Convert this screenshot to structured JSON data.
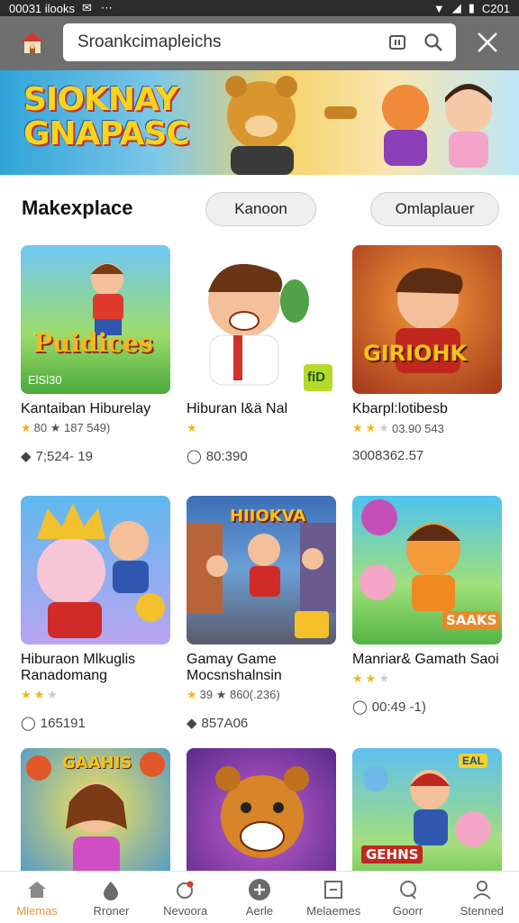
{
  "status_bar": {
    "left_text": "00031 ilooks",
    "time": "C201"
  },
  "search": {
    "value": "Sroankcimapleichs",
    "placeholder": ""
  },
  "banner": {
    "title_line1": "SIOKNAY",
    "title_line2": "GNAPASC"
  },
  "section": {
    "title": "Makexplace",
    "filters": [
      "Kanoon",
      "Omlaplauer"
    ]
  },
  "cards": [
    {
      "title": "Kantaiban Hiburelay",
      "meta": "80 ★ 187 549)",
      "rating": 1,
      "count": "7;524- 19",
      "thumb_label": "Puidices",
      "thumb_corner": "ElSl30"
    },
    {
      "title": "Hiburan l&ä Nal",
      "meta": "",
      "rating": 0,
      "count": "80:390",
      "thumb_label": "",
      "thumb_corner": "fiD"
    },
    {
      "title": "Kbarpl:lotibesb",
      "meta": "03.90 543",
      "rating": 2,
      "count": "3008362.57",
      "thumb_label": "GIRIOHK",
      "thumb_corner": ""
    },
    {
      "title": "Hiburaon Mlkuglis Ranadomang",
      "meta": "",
      "rating": 2,
      "count": "165191",
      "thumb_label": "",
      "thumb_corner": ""
    },
    {
      "title": "Gamay Game Mocsnshalnsin",
      "meta": "39 ★ 860(.236)",
      "rating": 1,
      "count": "857A06",
      "thumb_label": "HIIOKVA",
      "thumb_corner": ""
    },
    {
      "title": "Manriar& Gamath Saoi",
      "meta": "",
      "rating": 2,
      "count": "00:49 -1)",
      "thumb_label": "SAAKS",
      "thumb_corner": ""
    },
    {
      "title": "",
      "meta": "",
      "rating": 0,
      "count": "",
      "thumb_label": "GAAHIS",
      "thumb_corner": ""
    },
    {
      "title": "",
      "meta": "",
      "rating": 0,
      "count": "",
      "thumb_label": "",
      "thumb_corner": ""
    },
    {
      "title": "",
      "meta": "",
      "rating": 0,
      "count": "",
      "thumb_label": "GEHNS",
      "thumb_corner": "EAL"
    }
  ],
  "bottom_nav": [
    {
      "label": "Mlemas",
      "icon": "home-icon",
      "active": true
    },
    {
      "label": "Rroner",
      "icon": "drop-icon",
      "active": false
    },
    {
      "label": "Nevoora",
      "icon": "notification-icon",
      "active": false
    },
    {
      "label": "Aerle",
      "icon": "plus-circle-icon",
      "active": false
    },
    {
      "label": "Melaemes",
      "icon": "square-icon",
      "active": false
    },
    {
      "label": "Goorr",
      "icon": "search-icon",
      "active": false
    },
    {
      "label": "Stenned",
      "icon": "user-icon",
      "active": false
    }
  ],
  "colors": {
    "accent": "#e8953a",
    "top_bar": "#6f6f6f",
    "star": "#f2b411"
  }
}
